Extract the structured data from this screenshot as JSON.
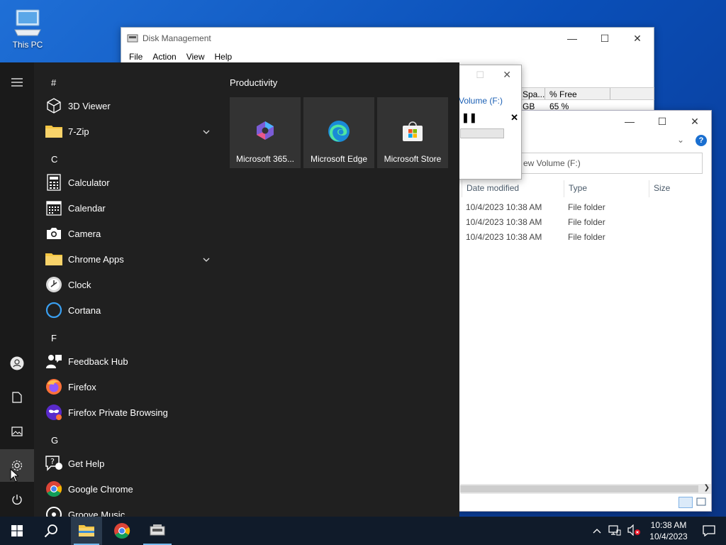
{
  "desktop": {
    "this_pc_label": "This PC"
  },
  "disk_management": {
    "title": "Disk Management",
    "menu": [
      "File",
      "Action",
      "View",
      "Help"
    ],
    "columns": [
      "Spa...",
      "% Free"
    ],
    "row": [
      "GB",
      "65 %"
    ]
  },
  "progress_dialog": {
    "volume_label": "Volume (F:)",
    "progress_fraction": 0.0
  },
  "explorer": {
    "search_placeholder": "ew Volume (F:)",
    "columns": [
      "Date modified",
      "Type",
      "Size"
    ],
    "rows": [
      {
        "date": "10/4/2023 10:38 AM",
        "type": "File folder"
      },
      {
        "date": "10/4/2023 10:38 AM",
        "type": "File folder"
      },
      {
        "date": "10/4/2023 10:38 AM",
        "type": "File folder"
      }
    ]
  },
  "start_menu": {
    "letters": [
      "#",
      "C",
      "F",
      "G"
    ],
    "apps": [
      {
        "label": "3D Viewer",
        "icon": "cube-icon"
      },
      {
        "label": "7-Zip",
        "icon": "folder-icon",
        "expandable": true
      },
      {
        "label": "Calculator",
        "icon": "calculator-icon"
      },
      {
        "label": "Calendar",
        "icon": "calendar-icon"
      },
      {
        "label": "Camera",
        "icon": "camera-icon"
      },
      {
        "label": "Chrome Apps",
        "icon": "folder-icon",
        "expandable": true
      },
      {
        "label": "Clock",
        "icon": "clock-icon"
      },
      {
        "label": "Cortana",
        "icon": "cortana-icon"
      },
      {
        "label": "Feedback Hub",
        "icon": "feedback-icon"
      },
      {
        "label": "Firefox",
        "icon": "firefox-icon"
      },
      {
        "label": "Firefox Private Browsing",
        "icon": "firefox-private-icon"
      },
      {
        "label": "Get Help",
        "icon": "help-icon"
      },
      {
        "label": "Google Chrome",
        "icon": "chrome-icon"
      },
      {
        "label": "Groove Music",
        "icon": "music-icon"
      }
    ],
    "tiles_group": "Productivity",
    "tiles": [
      {
        "label": "Microsoft 365...",
        "icon": "m365-icon"
      },
      {
        "label": "Microsoft Edge",
        "icon": "edge-icon"
      },
      {
        "label": "Microsoft Store",
        "icon": "store-icon"
      }
    ]
  },
  "taskbar": {
    "time": "10:38 AM",
    "date": "10/4/2023"
  },
  "colors": {
    "start_bg": "#202020",
    "taskbar_bg": "#101b2a",
    "accent": "#0078d4"
  }
}
